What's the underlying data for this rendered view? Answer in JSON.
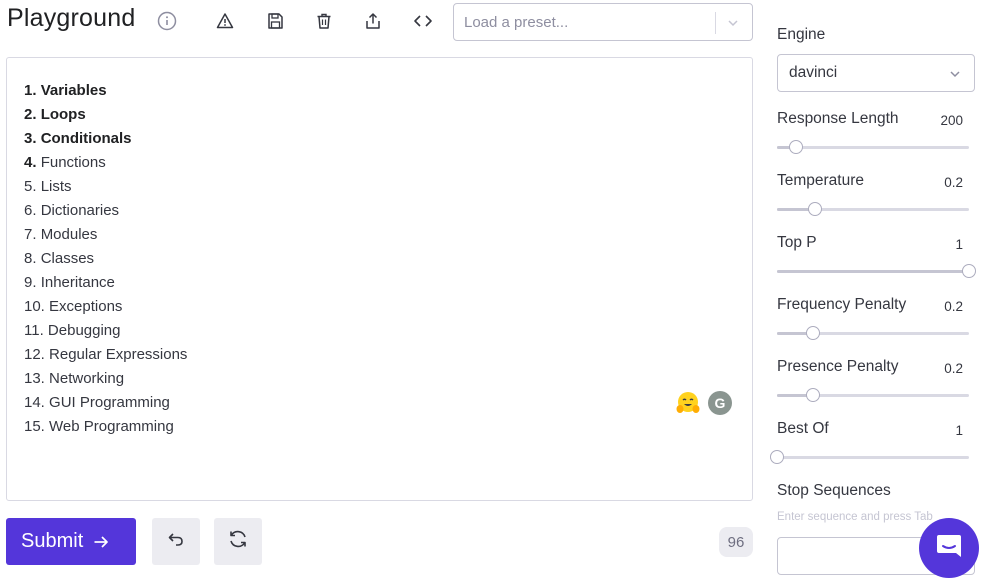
{
  "header": {
    "title": "Playground",
    "toolbar_icons": [
      "warning-icon",
      "save-icon",
      "trash-icon",
      "share-icon",
      "code-icon"
    ],
    "preset": {
      "placeholder": "Load a preset..."
    }
  },
  "editor": {
    "lines": [
      {
        "num": "1.",
        "text": "Variables",
        "bold": true
      },
      {
        "num": "2.",
        "text": "Loops",
        "bold": true
      },
      {
        "num": "3.",
        "text": "Conditionals",
        "bold": true
      },
      {
        "num": "4.",
        "text": "Functions",
        "bold": "num"
      },
      {
        "num": "5.",
        "text": "Lists"
      },
      {
        "num": "6.",
        "text": "Dictionaries"
      },
      {
        "num": "7.",
        "text": "Modules"
      },
      {
        "num": "8.",
        "text": "Classes"
      },
      {
        "num": "9.",
        "text": "Inheritance"
      },
      {
        "num": "10.",
        "text": "Exceptions"
      },
      {
        "num": "11.",
        "text": "Debugging"
      },
      {
        "num": "12.",
        "text": "Regular Expressions"
      },
      {
        "num": "13.",
        "text": "Networking"
      },
      {
        "num": "14.",
        "text": "GUI Programming"
      },
      {
        "num": "15.",
        "text": "Web Programming"
      }
    ],
    "badge_letter": "G"
  },
  "actions": {
    "submit_label": "Submit",
    "token_count": "96"
  },
  "settings": {
    "engine_label": "Engine",
    "engine_value": "davinci",
    "sliders": [
      {
        "label": "Response Length",
        "value": "200",
        "fraction": 0.1
      },
      {
        "label": "Temperature",
        "value": "0.2",
        "fraction": 0.2
      },
      {
        "label": "Top P",
        "value": "1",
        "fraction": 1.0
      },
      {
        "label": "Frequency Penalty",
        "value": "0.2",
        "fraction": 0.19
      },
      {
        "label": "Presence Penalty",
        "value": "0.2",
        "fraction": 0.19
      },
      {
        "label": "Best Of",
        "value": "1",
        "fraction": 0.0
      }
    ],
    "stop_label": "Stop Sequences",
    "stop_hint": "Enter sequence and press Tab"
  },
  "colors": {
    "accent": "#5436da",
    "text": "#353740",
    "border": "#c5c5d2"
  }
}
